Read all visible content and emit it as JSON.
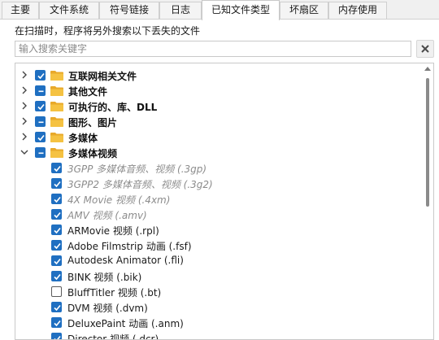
{
  "tabs": [
    {
      "label": "主要",
      "active": false
    },
    {
      "label": "文件系统",
      "active": false
    },
    {
      "label": "符号链接",
      "active": false
    },
    {
      "label": "日志",
      "active": false
    },
    {
      "label": "已知文件类型",
      "active": true
    },
    {
      "label": "坏扇区",
      "active": false
    },
    {
      "label": "内存使用",
      "active": false
    }
  ],
  "description": "在扫描时，程序将另外搜索以下丢失的文件",
  "search": {
    "placeholder": "输入搜索关键字",
    "value": ""
  },
  "colors": {
    "accent": "#1f6fc1",
    "folder": "#f5c242",
    "dim_text": "#8c8c8c"
  },
  "tree": [
    {
      "label": "互联网相关文件",
      "level": 0,
      "expander": "collapsed",
      "check": "checked",
      "folder": true,
      "style": "bold"
    },
    {
      "label": "其他文件",
      "level": 0,
      "expander": "collapsed",
      "check": "partial",
      "folder": true,
      "style": "bold"
    },
    {
      "label": "可执行的、库、DLL",
      "level": 0,
      "expander": "collapsed",
      "check": "checked",
      "folder": true,
      "style": "bold"
    },
    {
      "label": "图形、图片",
      "level": 0,
      "expander": "collapsed",
      "check": "partial",
      "folder": true,
      "style": "bold"
    },
    {
      "label": "多媒体",
      "level": 0,
      "expander": "collapsed",
      "check": "checked",
      "folder": true,
      "style": "bold"
    },
    {
      "label": "多媒体视频",
      "level": 0,
      "expander": "expanded",
      "check": "partial",
      "folder": true,
      "style": "bold"
    },
    {
      "label": "3GPP 多媒体音频、视频 (.3gp)",
      "level": 1,
      "check": "checked",
      "style": "dim"
    },
    {
      "label": "3GPP2 多媒体音频、视频 (.3g2)",
      "level": 1,
      "check": "checked",
      "style": "dim"
    },
    {
      "label": "4X Movie 视频 (.4xm)",
      "level": 1,
      "check": "checked",
      "style": "dim"
    },
    {
      "label": "AMV 视频 (.amv)",
      "level": 1,
      "check": "checked",
      "style": "dim"
    },
    {
      "label": "ARMovie 视频 (.rpl)",
      "level": 1,
      "check": "checked",
      "style": "normal"
    },
    {
      "label": "Adobe Filmstrip 动画 (.fsf)",
      "level": 1,
      "check": "checked",
      "style": "normal"
    },
    {
      "label": "Autodesk Animator (.fli)",
      "level": 1,
      "check": "checked",
      "style": "normal"
    },
    {
      "label": "BINK 视频 (.bik)",
      "level": 1,
      "check": "checked",
      "style": "normal"
    },
    {
      "label": "BluffTitler 视频 (.bt)",
      "level": 1,
      "check": "unchecked",
      "style": "normal"
    },
    {
      "label": "DVM 视频 (.dvm)",
      "level": 1,
      "check": "checked",
      "style": "normal"
    },
    {
      "label": "DeluxePaint 动画 (.anm)",
      "level": 1,
      "check": "checked",
      "style": "normal"
    },
    {
      "label": "Director 视频 (.dcr)",
      "level": 1,
      "check": "checked",
      "style": "normal"
    }
  ]
}
